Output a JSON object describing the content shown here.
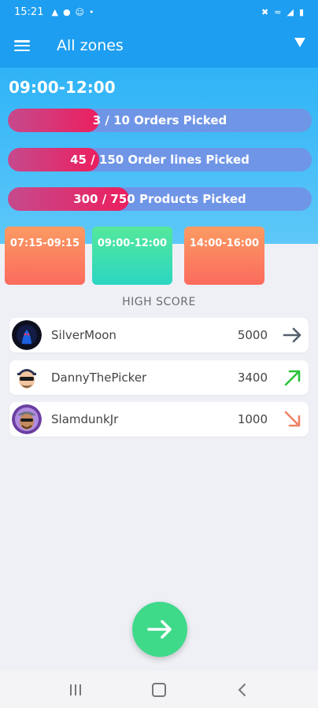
{
  "status_bar": {
    "time": "15:21",
    "left_icons": [
      "shopping-bag-icon",
      "figure-icon",
      "smiley-icon",
      "dot-icon"
    ],
    "right_icons": [
      "mute-icon",
      "wifi-icon",
      "signal-icon",
      "battery-icon"
    ]
  },
  "app_bar": {
    "title": "All zones",
    "menu_icon": "hamburger-menu-icon",
    "dropdown_icon": "dropdown-triangle-icon"
  },
  "current_slot": {
    "title": "09:00-12:00",
    "progress": [
      {
        "label": "3 / 10 Orders Picked",
        "value": 3,
        "total": 10
      },
      {
        "label": "45 / 150 Order lines Picked",
        "value": 45,
        "total": 150
      },
      {
        "label": "300 / 750 Products Picked",
        "value": 300,
        "total": 750
      }
    ]
  },
  "time_slots": [
    {
      "label": "07:15-09:15",
      "status_color": "#fb7a60"
    },
    {
      "label": "09:00-12:00",
      "status_color": "#3ddfae"
    },
    {
      "label": "14:00-16:00",
      "status_color": "#fb7a60"
    }
  ],
  "high_score": {
    "title": "HIGH SCORE",
    "rows": [
      {
        "name": "SilverMoon",
        "score": "5000",
        "trend": "same",
        "trend_color": "#555f6b"
      },
      {
        "name": "DannyThePicker",
        "score": "3400",
        "trend": "up",
        "trend_color": "#29c23a"
      },
      {
        "name": "SlamdunkJr",
        "score": "1000",
        "trend": "down",
        "trend_color": "#ee8166"
      }
    ]
  },
  "fab": {
    "icon": "arrow-right-icon",
    "color": "#3fd98a"
  },
  "nav_bar": {
    "buttons": [
      "recents-icon",
      "home-icon",
      "back-icon"
    ]
  }
}
